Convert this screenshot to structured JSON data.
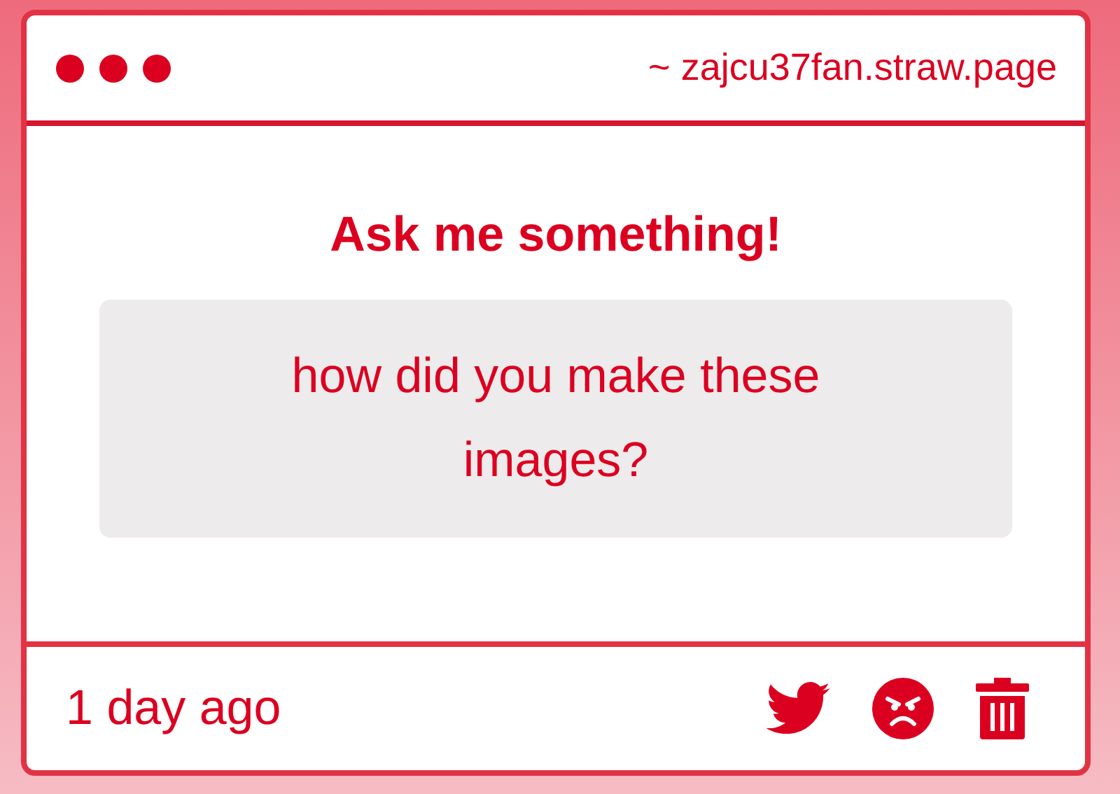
{
  "window": {
    "url": "~ zajcu37fan.straw.page"
  },
  "prompt": {
    "title": "Ask me something!"
  },
  "question": {
    "text": "how did you make these images?"
  },
  "footer": {
    "time": "1 day ago"
  }
}
